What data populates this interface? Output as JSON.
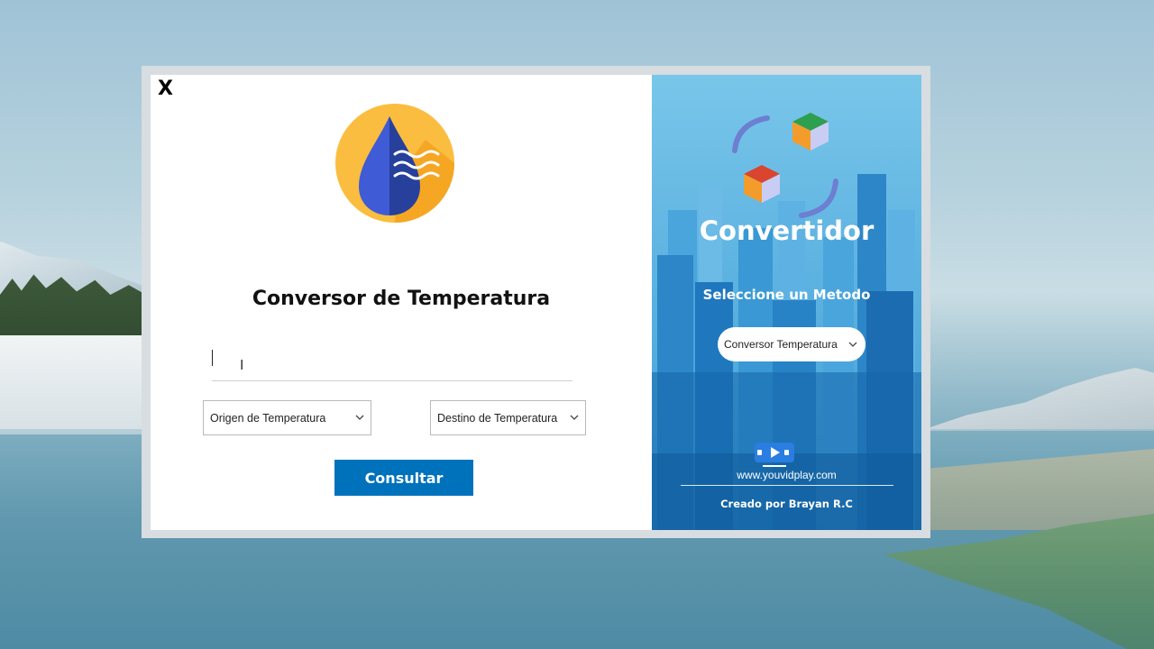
{
  "window": {
    "close_label": "X"
  },
  "converter": {
    "title": "Conversor de Temperatura",
    "input_value": "",
    "origin_select": "Origen de Temperatura",
    "destination_select": "Destino de Temperatura",
    "submit_label": "Consultar"
  },
  "side_panel": {
    "title": "Convertidor",
    "subtitle": "Seleccione un Metodo",
    "method_select": "Conversor Temperatura",
    "website": "www.youvidplay.com",
    "credit": "Creado por Brayan R.C"
  },
  "colors": {
    "primary_button": "#0072bc",
    "side_panel": "#5fb4e1"
  },
  "icons": [
    "close-icon",
    "water-drop-logo-icon",
    "chevron-down-icon",
    "cubes-sync-icon",
    "play-video-icon"
  ]
}
